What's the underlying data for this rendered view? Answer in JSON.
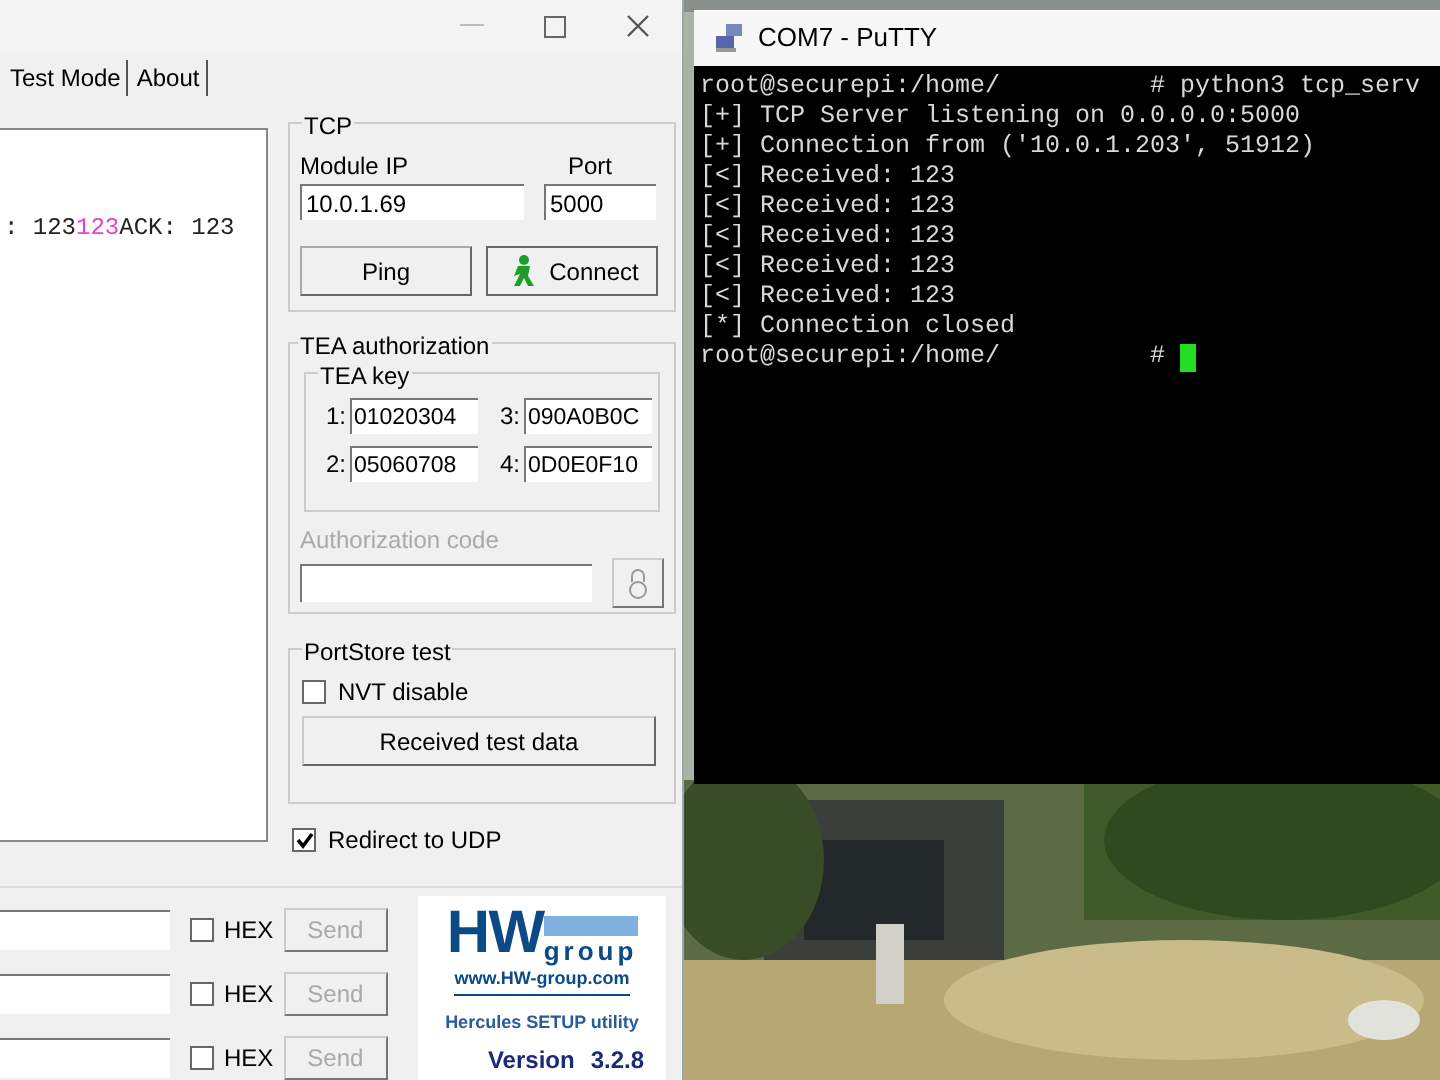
{
  "hercules": {
    "tabs": [
      {
        "label": "Test Mode"
      },
      {
        "label": "About"
      }
    ],
    "receive_text": [
      {
        "text": ": 123",
        "highlight": false
      },
      {
        "text": "123",
        "highlight": true
      },
      {
        "text": "ACK: 123",
        "highlight": false
      }
    ],
    "tcp": {
      "title": "TCP",
      "module_ip_label": "Module IP",
      "module_ip": "10.0.1.69",
      "port_label": "Port",
      "port": "5000",
      "ping_button": "Ping",
      "connect_button": "Connect"
    },
    "tea": {
      "title": "TEA authorization",
      "key_title": "TEA key",
      "keys": [
        {
          "label": "1:",
          "value": "01020304"
        },
        {
          "label": "3:",
          "value": "090A0B0C"
        },
        {
          "label": "2:",
          "value": "05060708"
        },
        {
          "label": "4:",
          "value": "0D0E0F10"
        }
      ],
      "auth_label": "Authorization code",
      "auth_disabled": true
    },
    "portstore": {
      "title": "PortStore test",
      "nvt": {
        "label": "NVT disable",
        "checked": false
      },
      "button": "Received test data"
    },
    "redirect": {
      "label": "Redirect to UDP",
      "checked": true
    },
    "send_rows": [
      {
        "hex_label": "HEX",
        "hex_checked": false,
        "button": "Send",
        "disabled": true
      },
      {
        "hex_label": "HEX",
        "hex_checked": false,
        "button": "Send",
        "disabled": true
      },
      {
        "hex_label": "HEX",
        "hex_checked": false,
        "button": "Send",
        "disabled": true
      }
    ],
    "logo": {
      "brand": "HW",
      "brand_suffix": "group",
      "url": "www.HW-group.com",
      "product": "Hercules SETUP utility",
      "version_label": "Version",
      "version": "3.2.8"
    }
  },
  "putty": {
    "title": "COM7 - PuTTY",
    "lines": [
      "root@securepi:/home/          # python3 tcp_serv",
      "[+] TCP Server listening on 0.0.0.0:5000",
      "[+] Connection from ('10.0.1.203', 51912)",
      "[<] Received: 123",
      "[<] Received: 123",
      "[<] Received: 123",
      "[<] Received: 123",
      "[<] Received: 123",
      "[*] Connection closed",
      "root@securepi:/home/          # "
    ],
    "cursor": true
  }
}
